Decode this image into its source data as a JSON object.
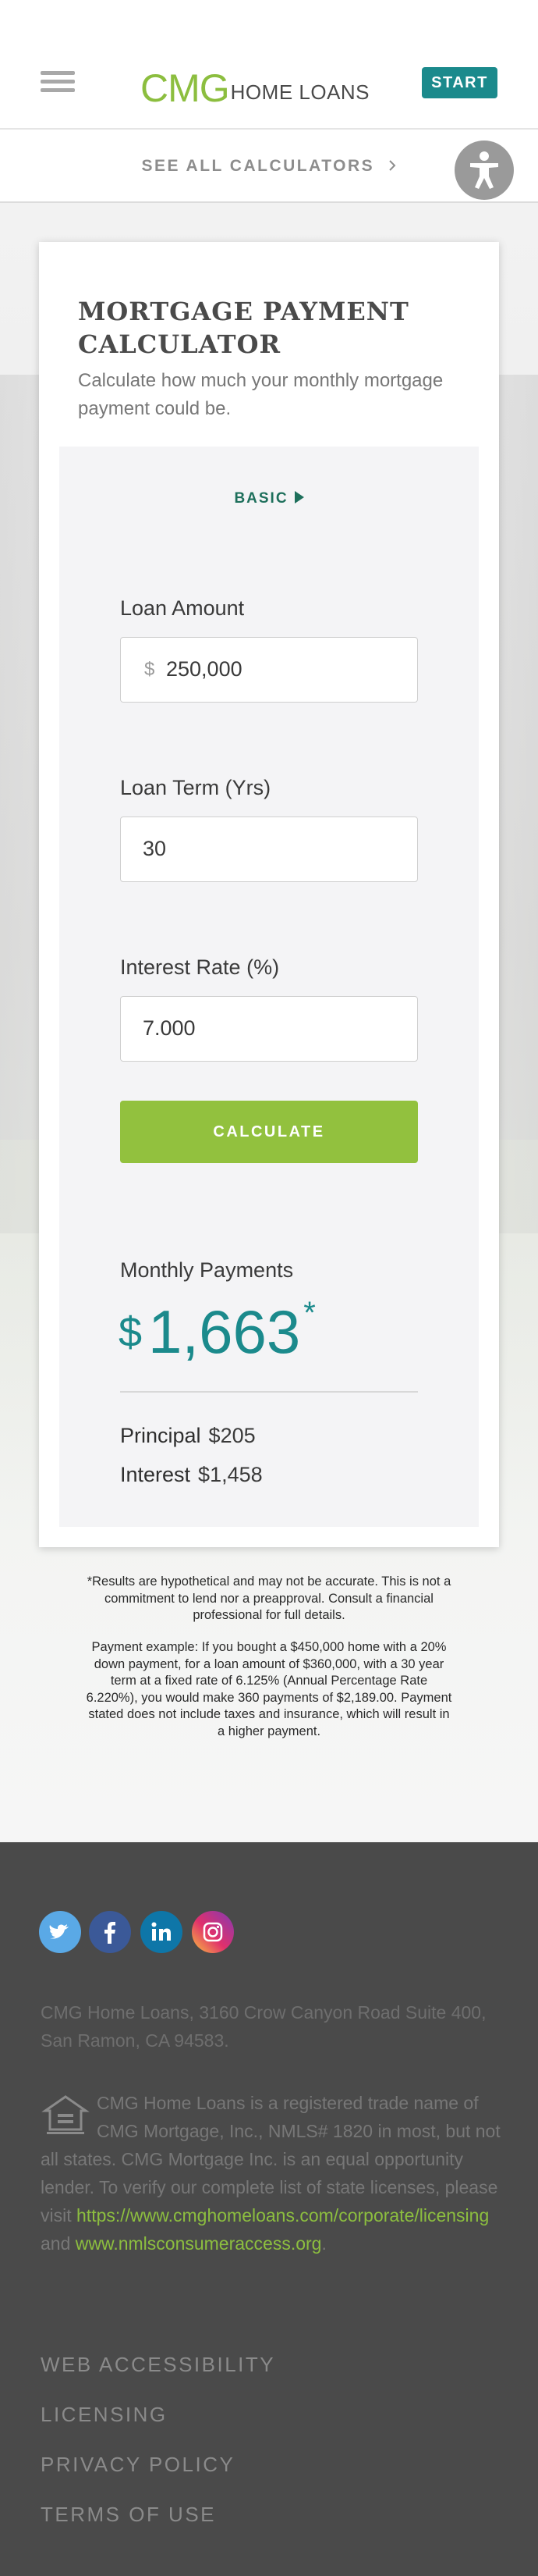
{
  "header": {
    "logo_cmg": "CMG",
    "logo_home": "HOME LOANS",
    "start_label": "START"
  },
  "subnav": {
    "see_all_label": "SEE ALL CALCULATORS"
  },
  "calculator": {
    "title": "MORTGAGE PAYMENT CALCULATOR",
    "subtitle": "Calculate how much your monthly mortgage payment could be.",
    "tab_label": "BASIC",
    "fields": {
      "loan_amount": {
        "label": "Loan Amount",
        "prefix": "$",
        "value": "250,000"
      },
      "loan_term": {
        "label": "Loan Term (Yrs)",
        "value": "30"
      },
      "interest_rate": {
        "label": "Interest Rate (%)",
        "value": "7.000"
      }
    },
    "calculate_label": "CALCULATE",
    "results": {
      "monthly_label": "Monthly Payments",
      "currency": "$",
      "monthly_value": "1,663",
      "asterisk": "*",
      "principal_label": "Principal",
      "principal_value": "$205",
      "interest_label": "Interest",
      "interest_value": "$1,458"
    }
  },
  "disclaimer": {
    "line1": "*Results are hypothetical and may not be accurate. This is not a commitment to lend nor a preapproval. Consult a financial professional for full details.",
    "line2": "Payment example: If you bought a $450,000 home with a 20% down payment, for a loan amount of $360,000, with a 30 year term at a fixed rate of 6.125% (Annual Percentage Rate 6.220%), you would make 360 payments of $2,189.00. Payment stated does not include taxes and insurance, which will result in a higher payment."
  },
  "footer": {
    "social_icons": [
      "twitter-icon",
      "facebook-icon",
      "linkedin-icon",
      "instagram-icon"
    ],
    "address": "CMG Home Loans, 3160 Crow Canyon Road Suite 400, San Ramon, CA 94583.",
    "legal_text": "CMG Home Loans is a registered trade name of CMG Mortgage, Inc., NMLS# 1820 in most, but not all states. CMG Mortgage Inc. is an equal opportunity lender. To verify our complete list of state licenses, please visit",
    "licensing_url": "https://www.cmghomeloans.com/corporate/licensing",
    "and_text": "and",
    "nmls_url": "www.nmlsconsumeraccess.org",
    "period": ".",
    "links": {
      "web_accessibility": "WEB ACCESSIBILITY",
      "licensing": "LICENSING",
      "privacy_policy": "PRIVACY POLICY",
      "terms_of_use": "TERMS OF USE"
    }
  },
  "colors": {
    "brand_green": "#8cbe3f",
    "teal": "#1b8a8c",
    "calculate_green": "#92c13e",
    "footer_bg": "#4a4a4a"
  }
}
